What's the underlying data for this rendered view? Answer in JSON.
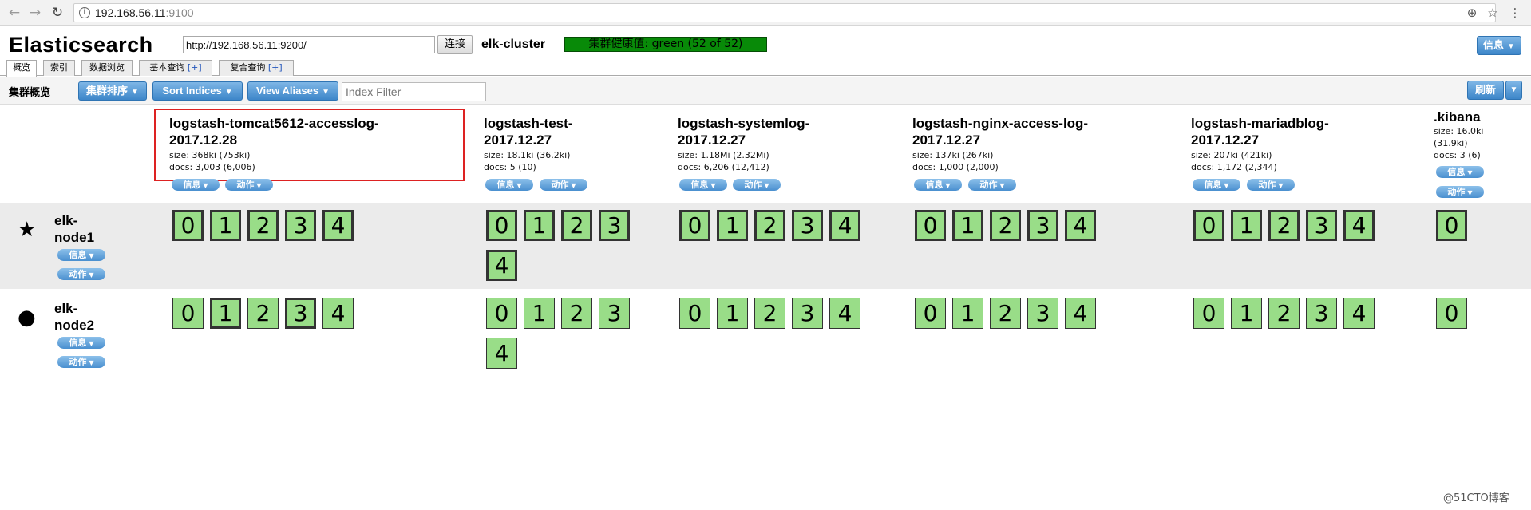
{
  "browser": {
    "url_host": "192.168.56.11",
    "url_port": ":9100",
    "info_icon": "i"
  },
  "app": {
    "title": "Elasticsearch",
    "connect_url": "http://192.168.56.11:9200/",
    "connect_label": "连接",
    "cluster_name": "elk-cluster",
    "health_text": "集群健康值: green (52 of 52)",
    "health_color": "#088a08",
    "info_label": "信息"
  },
  "tabs": [
    {
      "label": "概览"
    },
    {
      "label": "索引"
    },
    {
      "label": "数据浏览"
    },
    {
      "label": "基本查询",
      "plus": "[+]"
    },
    {
      "label": "复合查询",
      "plus": "[+]"
    }
  ],
  "toolbar": {
    "overview_label": "集群概览",
    "sort_cluster_label": "集群排序",
    "sort_indices_label": "Sort Indices",
    "view_aliases_label": "View Aliases",
    "filter_placeholder": "Index Filter",
    "refresh_label": "刷新"
  },
  "indices": [
    {
      "name1": "logstash-tomcat5612-accesslog-",
      "name2": "2017.12.28",
      "size": "size: 368ki (753ki)",
      "docs": "docs: 3,003 (6,006)"
    },
    {
      "name1": "logstash-test-",
      "name2": "2017.12.27",
      "size": "size: 18.1ki (36.2ki)",
      "docs": "docs: 5 (10)"
    },
    {
      "name1": "logstash-systemlog-",
      "name2": "2017.12.27",
      "size": "size: 1.18Mi (2.32Mi)",
      "docs": "docs: 6,206 (12,412)"
    },
    {
      "name1": "logstash-nginx-access-log-",
      "name2": "2017.12.27",
      "size": "size: 137ki (267ki)",
      "docs": "docs: 1,000 (2,000)"
    },
    {
      "name1": "logstash-mariadblog-",
      "name2": "2017.12.27",
      "size": "size: 207ki (421ki)",
      "docs": "docs: 1,172 (2,344)"
    },
    {
      "name1": ".kibana",
      "size1": "size: 16.0ki",
      "size2": "(31.9ki)",
      "docs": "docs: 3 (6)"
    }
  ],
  "buttons": {
    "info": "信息",
    "action": "动作"
  },
  "nodes": [
    {
      "name1": "elk-",
      "name2": "node1",
      "icon": "star-icon",
      "glyph": "★"
    },
    {
      "name1": "elk-",
      "name2": "node2",
      "icon": "circle-icon",
      "glyph": "●"
    }
  ],
  "shards": [
    "0",
    "1",
    "2",
    "3",
    "4"
  ],
  "watermark": "@51CTO博客"
}
